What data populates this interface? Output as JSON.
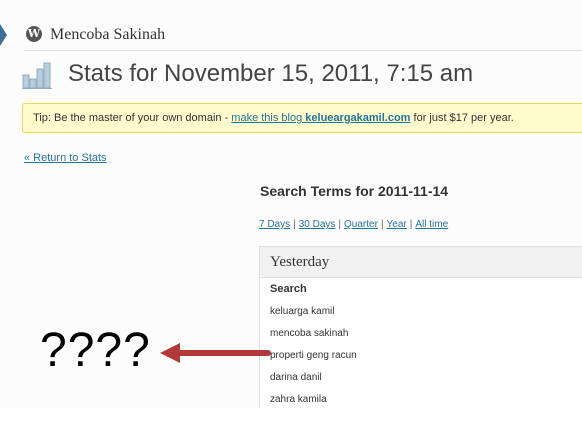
{
  "admin_bar": {
    "site_name": "Mencoba Sakinah",
    "logo_glyph": "W"
  },
  "page_title": "Stats for November 15, 2011, 7:15 am",
  "tip": {
    "prefix": "Tip: Be the master of your own domain - ",
    "link_text": "make this blog",
    "domain": "kelueargakamil.com",
    "suffix": " for just $17 per year."
  },
  "return_link": "« Return to Stats",
  "search_terms": {
    "title": "Search Terms for 2011-11-14",
    "ranges": [
      "7 Days",
      "30 Days",
      "Quarter",
      "Year",
      "All time"
    ],
    "box_title": "Yesterday",
    "column_header": "Search",
    "terms": [
      "keluarga kamil",
      "mencoba sakinah",
      "properti geng racun",
      "darina danil",
      "zahra kamila"
    ]
  },
  "annotation": {
    "text": "????",
    "arrow_color": "#b03a3a"
  },
  "colors": {
    "link": "#21759b",
    "tip_bg": "#fffbcc",
    "tip_border": "#e6db55",
    "admin_accent": "#3a6f96"
  }
}
